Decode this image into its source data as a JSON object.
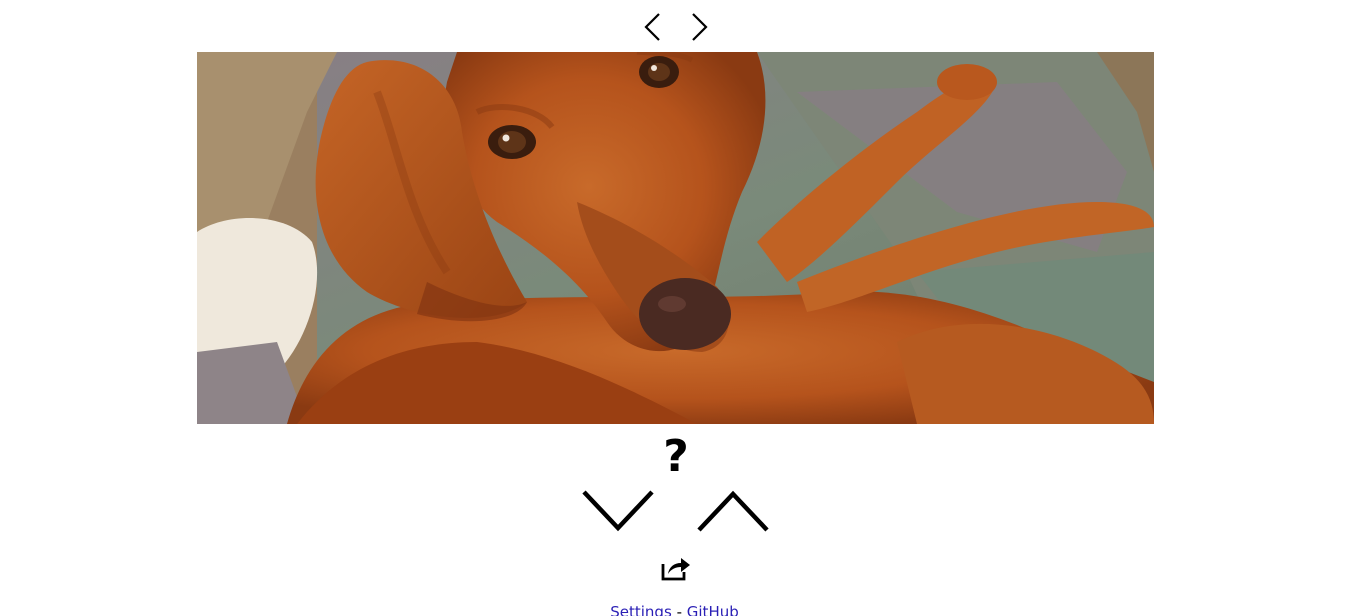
{
  "navigation": {
    "prev_icon": "chevron-left-icon",
    "next_icon": "chevron-right-icon"
  },
  "photo": {
    "subject": "dog",
    "colors": {
      "fur": "#b8561e",
      "blanket": "#7c8b78",
      "sofa": "#a88a68"
    }
  },
  "prompt": {
    "symbol": "?"
  },
  "voting": {
    "down_icon": "chevron-down-icon",
    "up_icon": "chevron-up-icon"
  },
  "share": {
    "icon": "share-icon"
  },
  "footer": {
    "settings_label": "Settings",
    "separator": "-",
    "github_label": "GitHub",
    "link_color": "#2a1fb5"
  }
}
